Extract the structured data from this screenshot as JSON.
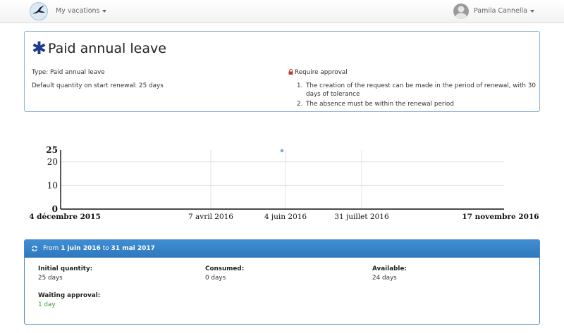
{
  "navbar": {
    "menu_label": "My vacations",
    "user_name": "Pamila Cannella",
    "icons": {
      "logo": "swallow-logo-icon",
      "menu_caret": "caret-down-icon",
      "user_caret": "caret-down-icon",
      "avatar": "user-avatar-icon"
    }
  },
  "leave": {
    "title": "Paid annual leave",
    "type_text": "Type: Paid annual leave",
    "quantity_text": "Default quantity on start renewal: 25 days",
    "approval_text": "Require approval",
    "rules": [
      {
        "num": "1.",
        "text": "The creation of the request can be made in the period of renewal, with 30 days of tolerance"
      },
      {
        "num": "2.",
        "text": "The absence must be within the renewal period"
      }
    ],
    "icons": {
      "title": "asterisk-icon",
      "approval": "lock-icon"
    },
    "accent_color": "#1f3a8c"
  },
  "chart_data": {
    "type": "scatter",
    "x_ticks": [
      "4 décembre 2015",
      "7 avril 2016",
      "4 juin 2016",
      "31 juillet 2016",
      "17 novembre 2016"
    ],
    "y_ticks": [
      "0",
      "10",
      "20",
      "25"
    ],
    "ylim": [
      0,
      25
    ],
    "grid": true,
    "points": [
      {
        "x": "4 juin 2016",
        "y": 25
      }
    ],
    "point_color": "#7fb0dc"
  },
  "period": {
    "from_label": "From",
    "from_date": "1 juin 2016",
    "to_label": "to",
    "to_date": "31 mai 2017",
    "icon": "refresh-icon",
    "header_color": "#337ab7",
    "stats": {
      "initial": {
        "label": "Initial quantity:",
        "value": "25 days"
      },
      "consumed": {
        "label": "Consumed:",
        "value": "0 days"
      },
      "available": {
        "label": "Available:",
        "value": "24 days"
      },
      "waiting": {
        "label": "Waiting approval:",
        "value": "1 day"
      }
    }
  }
}
